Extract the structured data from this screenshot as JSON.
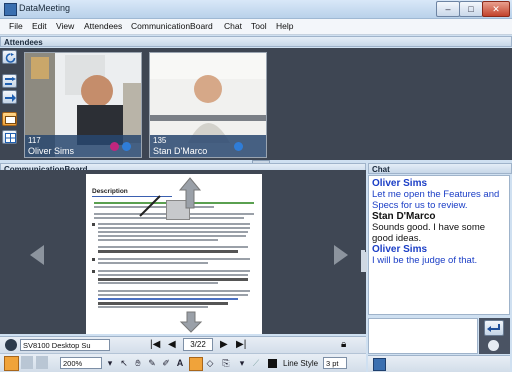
{
  "window": {
    "title": "DataMeeting"
  },
  "menu": [
    "File",
    "Edit",
    "View",
    "Attendees",
    "CommunicationBoard",
    "Chat",
    "Tool",
    "Help"
  ],
  "attendees": {
    "header": "Attendees",
    "tiles": [
      {
        "id": "117",
        "name": "Oliver Sims"
      },
      {
        "id": "135",
        "name": "Stan D'Marco"
      }
    ]
  },
  "board": {
    "header": "CommunicationBoard",
    "document_title": "Description",
    "page_select": "SV8100 Desktop Su",
    "page": "3/22",
    "zoom": "200%",
    "line_style_label": "Line Style",
    "line_style_value": "3 pt"
  },
  "chat": {
    "header": "Chat",
    "messages": [
      {
        "sender": "Oliver Sims",
        "text": "Let me open the Features and Specs for us to review."
      },
      {
        "sender": "Stan D'Marco",
        "text": "Sounds good.  I have some good ideas."
      },
      {
        "sender": "Oliver Sims",
        "text": "I will be the judge of that."
      }
    ]
  },
  "colors": {
    "accent_blue": "#1b3ec6",
    "panel_dark": "#3e4653",
    "title_bar": "#c6d9ee"
  }
}
